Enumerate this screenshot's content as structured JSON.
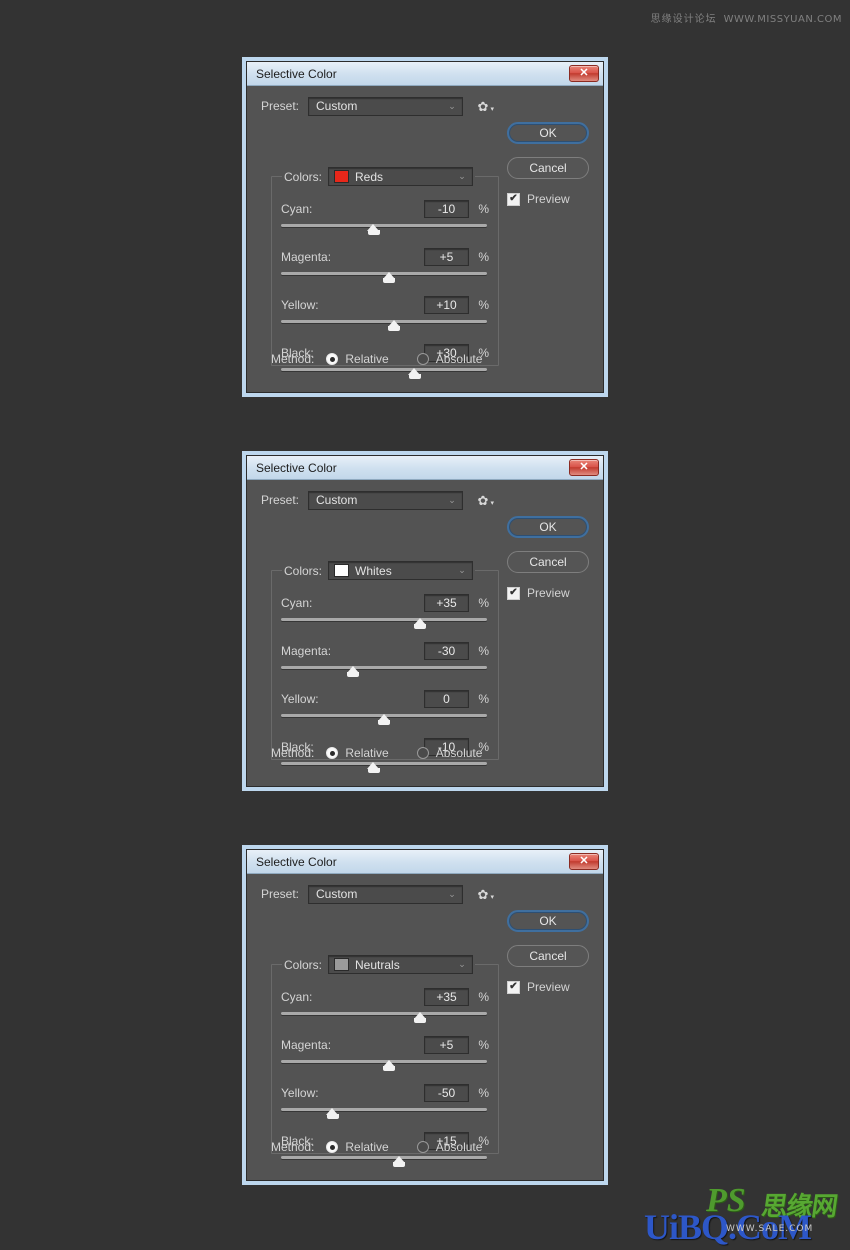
{
  "page": {
    "background_color": "#333333"
  },
  "watermarks": {
    "top_right_cn": "思缘设计论坛",
    "top_right_url": "WWW.MISSYUAN.COM",
    "bottom_ps": "PS",
    "bottom_cn": "思缘网",
    "bottom_brand": "UiBQ.CoM",
    "bottom_sub": "WWW.SALE.COM"
  },
  "labels": {
    "preset": "Preset:",
    "colors": "Colors:",
    "method": "Method:",
    "percent": "%",
    "cyan": "Cyan:",
    "magenta": "Magenta:",
    "yellow": "Yellow:",
    "black": "Black:",
    "relative": "Relative",
    "absolute": "Absolute",
    "ok": "OK",
    "cancel": "Cancel",
    "preview": "Preview",
    "close_glyph": "✕",
    "chevron_glyph": "⌄",
    "gear_glyph": "✿",
    "gear_arrow_glyph": "▾",
    "check_glyph": "✔"
  },
  "dialogs": [
    {
      "title": "Selective Color",
      "preset": "Custom",
      "colors_value": "Reds",
      "colors_swatch": "#e8271a",
      "method_relative": true,
      "method_absolute": false,
      "preview_checked": true,
      "sliders": [
        {
          "name": "Cyan:",
          "value": "-10",
          "pct": -10
        },
        {
          "name": "Magenta:",
          "value": "+5",
          "pct": 5
        },
        {
          "name": "Yellow:",
          "value": "+10",
          "pct": 10
        },
        {
          "name": "Black:",
          "value": "+30",
          "pct": 30
        }
      ]
    },
    {
      "title": "Selective Color",
      "preset": "Custom",
      "colors_value": "Whites",
      "colors_swatch": "#ffffff",
      "method_relative": true,
      "method_absolute": false,
      "preview_checked": true,
      "sliders": [
        {
          "name": "Cyan:",
          "value": "+35",
          "pct": 35
        },
        {
          "name": "Magenta:",
          "value": "-30",
          "pct": -30
        },
        {
          "name": "Yellow:",
          "value": "0",
          "pct": 0
        },
        {
          "name": "Black:",
          "value": "-10",
          "pct": -10
        }
      ]
    },
    {
      "title": "Selective Color",
      "preset": "Custom",
      "colors_value": "Neutrals",
      "colors_swatch": "#9a9a9a",
      "method_relative": true,
      "method_absolute": false,
      "preview_checked": true,
      "sliders": [
        {
          "name": "Cyan:",
          "value": "+35",
          "pct": 35
        },
        {
          "name": "Magenta:",
          "value": "+5",
          "pct": 5
        },
        {
          "name": "Yellow:",
          "value": "-50",
          "pct": -50
        },
        {
          "name": "Black:",
          "value": "+15",
          "pct": 15
        }
      ]
    }
  ]
}
